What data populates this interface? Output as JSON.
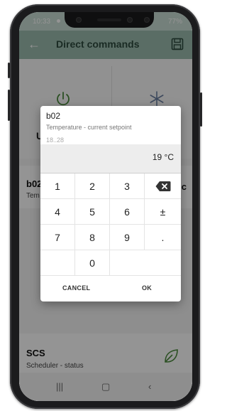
{
  "statusbar": {
    "time": "10:33",
    "battery": "77%"
  },
  "appbar": {
    "back_icon": "arrow-back-icon",
    "title": "Direct commands",
    "save_icon": "save-icon"
  },
  "background": {
    "tile_left_label": "U",
    "row2": {
      "code": "b02",
      "desc": "Tem",
      "right": "c"
    },
    "scs": {
      "code": "SCS",
      "desc": "Scheduler - status"
    }
  },
  "dialog": {
    "code": "b02",
    "description": "Temperature - current setpoint",
    "range": "18..28",
    "value": "19 °C",
    "keys": [
      [
        "1",
        "2",
        "3",
        "backspace"
      ],
      [
        "4",
        "5",
        "6",
        "±"
      ],
      [
        "7",
        "8",
        "9",
        "."
      ],
      [
        "",
        "0",
        "",
        ""
      ]
    ],
    "cancel": "CANCEL",
    "ok": "OK"
  },
  "colors": {
    "accent": "#9bbcae",
    "leaf": "#4a8a3c"
  }
}
